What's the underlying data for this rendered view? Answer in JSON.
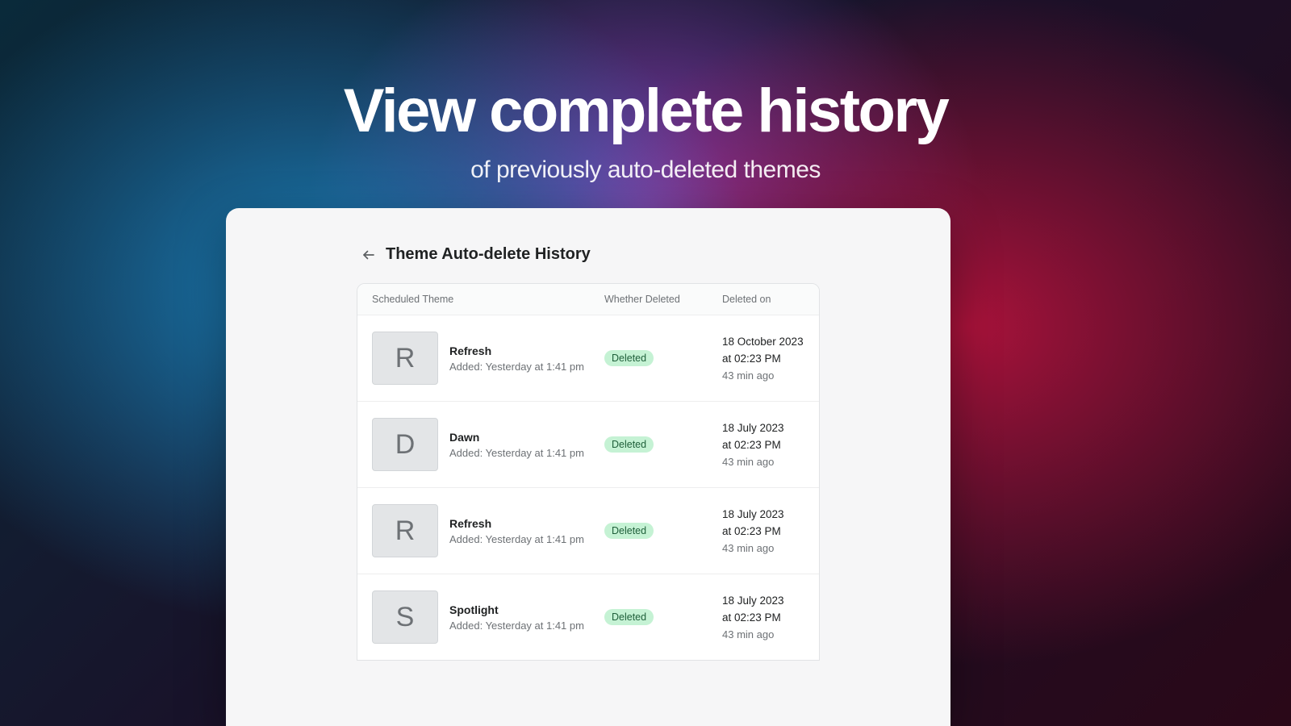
{
  "hero": {
    "title": "View complete history",
    "subtitle": "of previously auto-deleted themes"
  },
  "panel": {
    "title": "Theme Auto-delete History"
  },
  "table": {
    "headers": {
      "theme": "Scheduled Theme",
      "status": "Whether Deleted",
      "deleted_on": "Deleted on"
    },
    "rows": [
      {
        "initial": "R",
        "name": "Refresh",
        "added": "Added: Yesterday at 1:41 pm",
        "status": "Deleted",
        "deleted_line1": "18 October 2023",
        "deleted_line2": "at 02:23 PM",
        "ago": "43 min ago"
      },
      {
        "initial": "D",
        "name": "Dawn",
        "added": "Added: Yesterday at 1:41 pm",
        "status": "Deleted",
        "deleted_line1": "18 July 2023",
        "deleted_line2": "at 02:23 PM",
        "ago": "43 min ago"
      },
      {
        "initial": "R",
        "name": "Refresh",
        "added": "Added: Yesterday at 1:41 pm",
        "status": "Deleted",
        "deleted_line1": "18 July 2023",
        "deleted_line2": "at 02:23 PM",
        "ago": "43 min ago"
      },
      {
        "initial": "S",
        "name": "Spotlight",
        "added": "Added: Yesterday at 1:41 pm",
        "status": "Deleted",
        "deleted_line1": "18 July 2023",
        "deleted_line2": "at 02:23 PM",
        "ago": "43 min ago"
      }
    ]
  }
}
